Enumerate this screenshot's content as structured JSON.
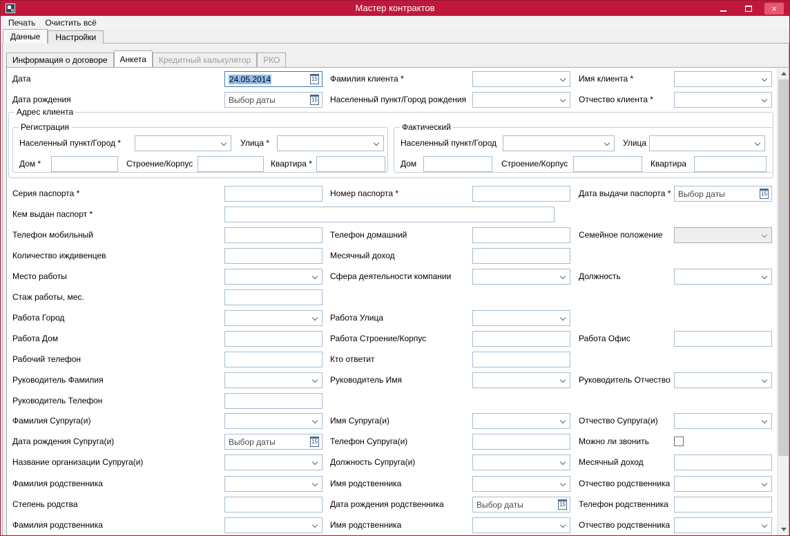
{
  "window": {
    "title": "Мастер контрактов"
  },
  "menu": {
    "print": "Печать",
    "clear_all": "Очистить всё"
  },
  "main_tabs": {
    "data": "Данные",
    "settings": "Настройки"
  },
  "inner_tabs": {
    "contract_info": "Информация о договоре",
    "questionnaire": "Анкета",
    "credit_calculator": "Кредитный калькулятор",
    "rko": "РКО"
  },
  "colors": {
    "titlebar": "#C0183C",
    "close_button": "#E8586C",
    "selection": "#92BEEC",
    "control_border": "#A4BCD2",
    "disabled_tab_text": "#9B9B9B"
  },
  "form": {
    "datepicker_placeholder": "Выбор даты",
    "calendar_day": "15",
    "date_value": "24.05.2014",
    "labels": {
      "date": "Дата",
      "client_surname": "Фамилия клиента *",
      "client_name": "Имя клиента *",
      "birth_date": "Дата рождения",
      "birth_place": "Населенный пункт/Город рождения",
      "client_patronymic": "Отчество клиента *",
      "client_address": "Адрес клиента",
      "registration": "Регистрация",
      "actual": "Фактический",
      "reg_city": "Населенный пункт/Город *",
      "reg_street": "Улица *",
      "reg_house": "Дом *",
      "building": "Строение/Корпус",
      "reg_apartment": "Квартира *",
      "fact_city": "Населенный пункт/Город",
      "fact_street": "Улица",
      "fact_house": "Дом",
      "fact_apartment": "Квартира",
      "passport_series": "Серия паспорта *",
      "passport_number": "Номер паспорта *",
      "passport_issue_date": "Дата выдачи паспорта *",
      "passport_issuer": "Кем выдан паспорт *",
      "mobile_phone": "Телефон мобильный",
      "home_phone": "Телефон домашний",
      "marital_status": "Семейное положение",
      "dependents": "Количество иждивенцев",
      "monthly_income": "Месячный доход",
      "workplace": "Место работы",
      "company_sphere": "Сфера деятельности компании",
      "position": "Должность",
      "work_experience": "Стаж работы, мес.",
      "work_city": "Работа Город",
      "work_street": "Работа Улица",
      "work_house": "Работа Дом",
      "work_building": "Работа Строение/Корпус",
      "work_office": "Работа Офис",
      "work_phone": "Рабочий телефон",
      "who_answers": "Кто ответит",
      "manager_surname": "Руководитель Фамилия",
      "manager_name": "Руководитель Имя",
      "manager_patronymic": "Руководитель Отчество",
      "manager_phone": "Руководитель Телефон",
      "spouse_surname": "Фамилия Супруга(и)",
      "spouse_name": "Имя Супруга(и)",
      "spouse_patronymic": "Отчество Супруга(и)",
      "spouse_birth_date": "Дата рождения Супруга(и)",
      "spouse_phone": "Телефон Супруга(и)",
      "can_call": "Можно ли звонить",
      "spouse_org": "Название организации Супруга(и)",
      "spouse_position": "Должность Супруга(и)",
      "relative_surname": "Фамилия родственника",
      "relative_name": "Имя родственника",
      "relative_patronymic": "Отчество родственника",
      "kinship": "Степень родства",
      "relative_birth_date": "Дата рождения родственника",
      "relative_phone": "Телефон родственника"
    }
  }
}
